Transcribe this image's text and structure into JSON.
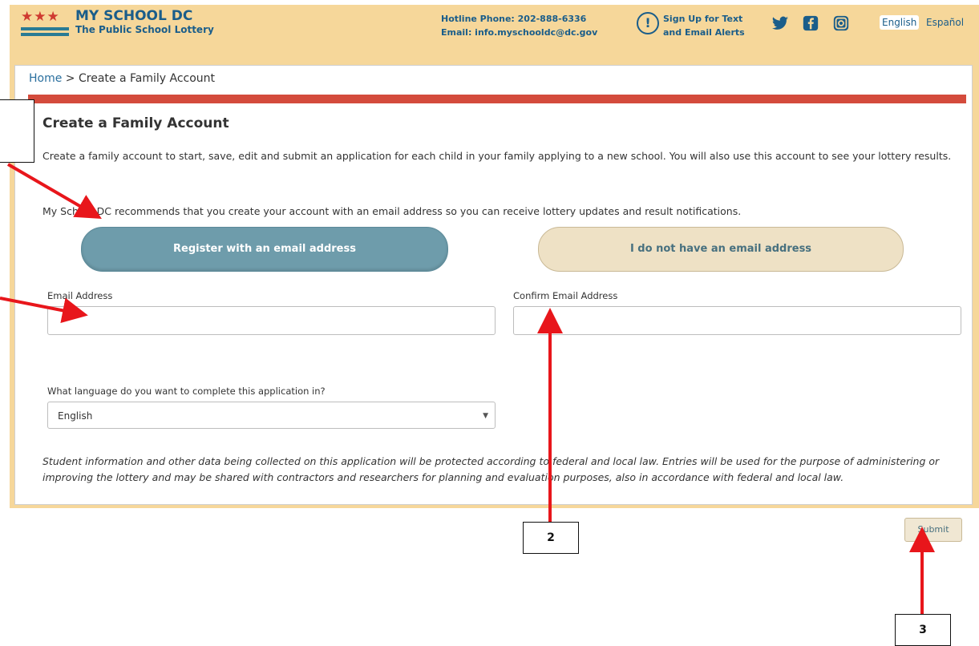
{
  "header": {
    "logo_title": "MY SCHOOL DC",
    "logo_subtitle": "The Public School Lottery",
    "hotline": "Hotline Phone: 202-888-6336",
    "email_line": "Email: info.myschooldc@dc.gov",
    "alerts_line1": "Sign Up for Text",
    "alerts_line2": "and Email Alerts",
    "lang_english": "English",
    "lang_spanish": "Español"
  },
  "breadcrumb": {
    "home": "Home",
    "separator": " > ",
    "current": "Create a Family Account"
  },
  "page": {
    "title": "Create a Family Account",
    "intro": "Create a family account to start, save, edit and submit an application for each child in your family applying to a new school. You will also use this account to see your lottery results.",
    "recommendation": "My School DC recommends that you create your account with an email address so you can receive lottery updates and result notifications."
  },
  "buttons": {
    "register_email": "Register with an email address",
    "no_email": "I do not have an email address",
    "submit": "Submit"
  },
  "form": {
    "email_label": "Email Address",
    "email_value": "",
    "confirm_label": "Confirm Email Address",
    "confirm_value": "",
    "language_question": "What language do you want to complete this application in?",
    "language_selected": "English"
  },
  "disclaimer": "Student information and other data being collected on this application will be protected according to federal and local law. Entries will be used for the purpose of administering or improving the lottery and may be shared with contractors and researchers for planning and evaluation purposes, also in accordance with federal and local law.",
  "annotations": {
    "callout_2": "2",
    "callout_3": "3"
  },
  "colors": {
    "banner": "#f6d79a",
    "accent_red": "#d44b3c",
    "brand_blue": "#1a5d8a",
    "register_btn": "#6e9cab",
    "arrow": "#e8161b"
  },
  "icons": [
    "star-icon",
    "alert-icon",
    "twitter-icon",
    "facebook-icon",
    "instagram-icon",
    "dropdown-caret-icon"
  ]
}
